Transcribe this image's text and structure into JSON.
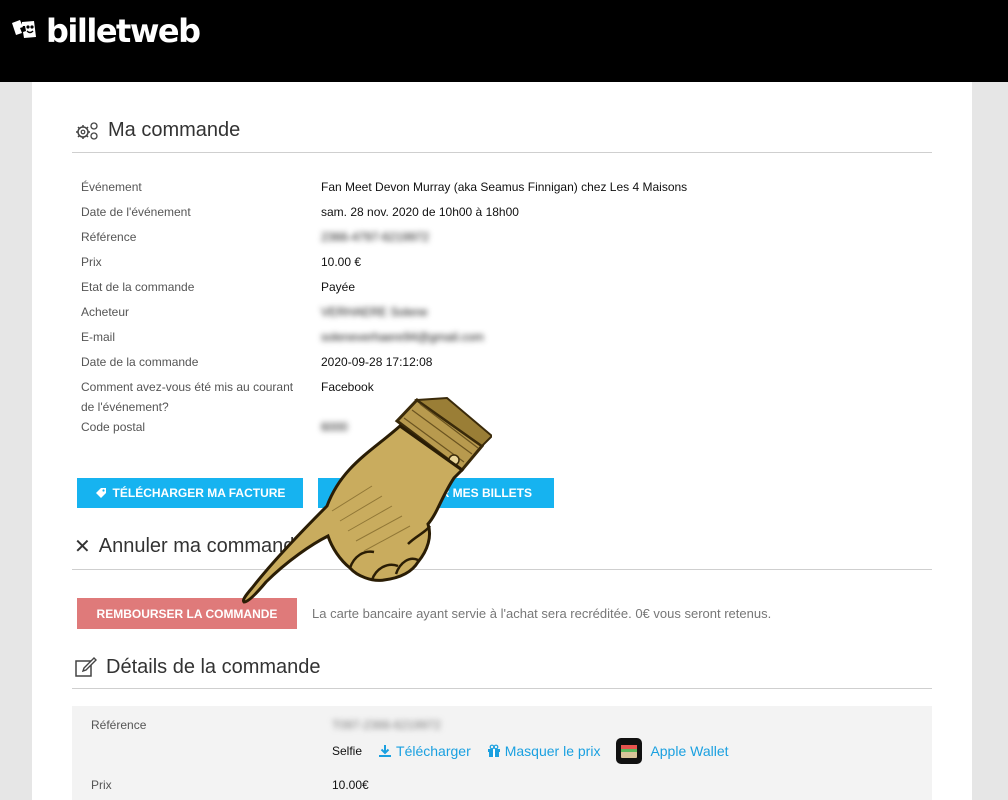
{
  "brand": {
    "name": "billetweb"
  },
  "order": {
    "title": "Ma commande",
    "rows": [
      {
        "label": "Événement",
        "value": "Fan Meet Devon Murray (aka Seamus Finnigan) chez Les 4 Maisons"
      },
      {
        "label": "Date de l'événement",
        "value": "sam. 28 nov. 2020 de 10h00 à 18h00"
      },
      {
        "label": "Référence",
        "value": "2366-4797-6219972"
      },
      {
        "label": "Prix",
        "value": "10.00 €"
      },
      {
        "label": "Etat de la commande",
        "value": "Payée"
      },
      {
        "label": "Acheteur",
        "value": "VERHAERE Solene"
      },
      {
        "label": "E-mail",
        "value": "soleneverhaere94@gmail.com"
      },
      {
        "label": "Date de la commande",
        "value": "2020-09-28 17:12:08"
      },
      {
        "label": "Comment avez-vous été mis au courant de l'événement?",
        "value": "Facebook"
      },
      {
        "label": "Code postal",
        "value": "6000"
      }
    ],
    "buttons": {
      "invoice": "TÉLÉCHARGER MA FACTURE",
      "tickets": "TÉLÉCHARGER MES BILLETS"
    }
  },
  "cancel": {
    "title": "Annuler ma commande",
    "refund_button": "REMBOURSER LA COMMANDE",
    "note": "La carte bancaire ayant servie à l'achat sera recréditée. 0€ vous seront retenus."
  },
  "details": {
    "title": "Détails de la commande",
    "reference_label": "Référence",
    "reference_value": "T097-2366-6219972",
    "ticket_type": "Selfie",
    "download_link": "Télécharger",
    "hide_price_link": "Masquer le prix",
    "wallet_link": "Apple Wallet",
    "price_label": "Prix",
    "price_value": "10.00€"
  }
}
